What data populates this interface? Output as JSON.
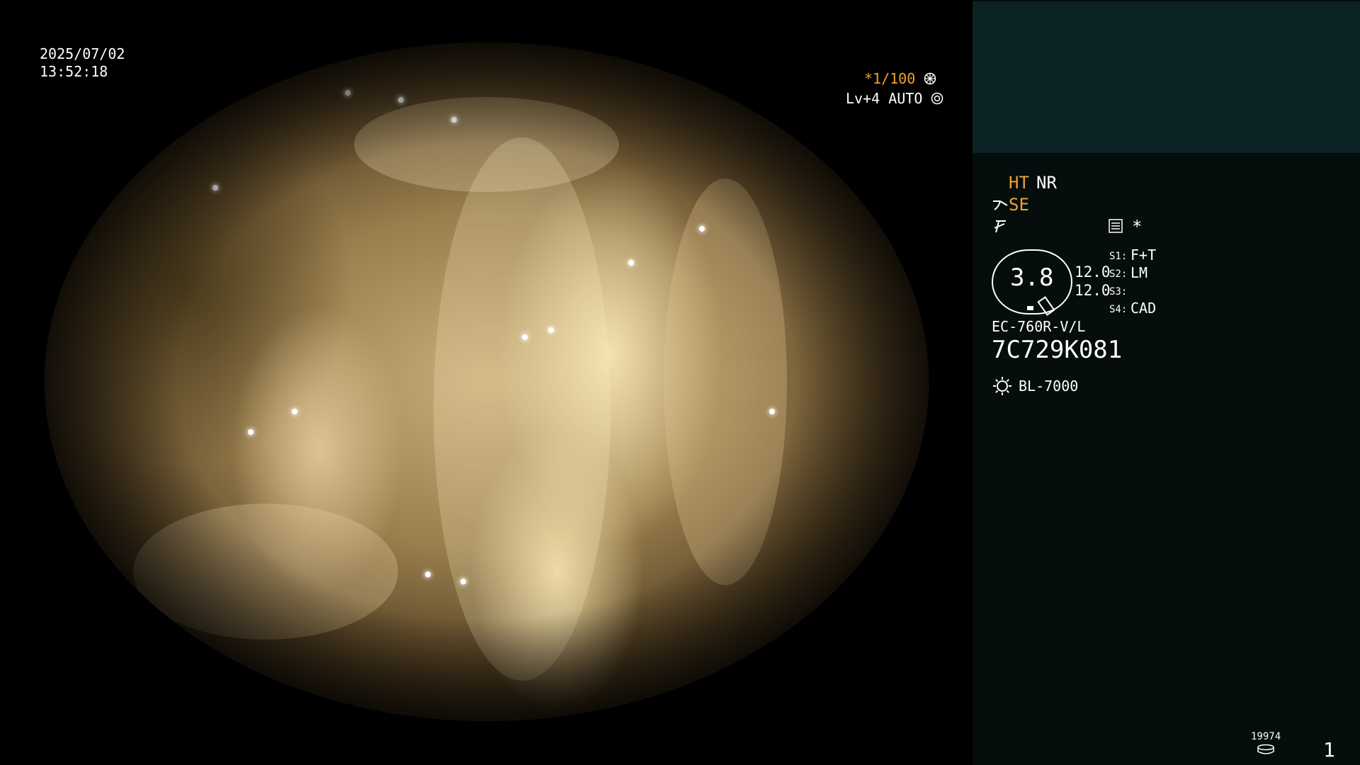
{
  "overlay": {
    "date": "2025/07/02",
    "time": "13:52:18",
    "shutter_star": "*",
    "shutter": "1/100",
    "level": "Lv+4 AUTO"
  },
  "panel": {
    "ht": "HT",
    "nr": "NR",
    "se": "SE",
    "asterisk": "*",
    "gauge_value": "3.8",
    "val_top": "12.0",
    "val_bottom": "12.0",
    "s1_label": "S1:",
    "s1_value": "F+T",
    "s2_label": "S2:",
    "s2_value": "LM",
    "s3_label": "S3:",
    "s3_value": "",
    "s4_label": "S4:",
    "s4_value": "CAD",
    "scope_model": "EC-760R-V/L",
    "scope_serial": "7C729K081",
    "light_source": "BL-7000",
    "image_counter": "19974",
    "page_number": "1"
  },
  "colors": {
    "accent_orange": "#f0a030",
    "panel_bg": "#050d0d",
    "panel_top_box": "#0b2324",
    "text": "#ffffff"
  }
}
